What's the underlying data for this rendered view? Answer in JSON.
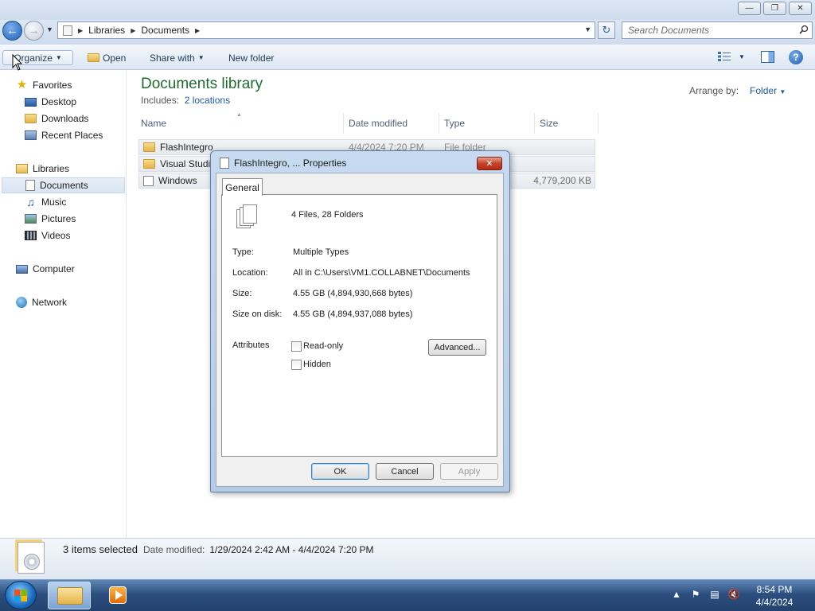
{
  "window": {
    "minimize_icon": "minimize-icon",
    "maximize_icon": "restore-icon",
    "close_icon": "close-icon"
  },
  "address": {
    "crumbs": [
      "Libraries",
      "Documents"
    ],
    "search_placeholder": "Search Documents"
  },
  "toolbar": {
    "organize": "Organize",
    "open": "Open",
    "share_with": "Share with",
    "new_folder": "New folder"
  },
  "sidebar": {
    "favorites": "Favorites",
    "desktop": "Desktop",
    "downloads": "Downloads",
    "recent_places": "Recent Places",
    "libraries": "Libraries",
    "documents": "Documents",
    "music": "Music",
    "pictures": "Pictures",
    "videos": "Videos",
    "computer": "Computer",
    "network": "Network"
  },
  "library": {
    "title": "Documents library",
    "includes_label": "Includes:",
    "locations": "2 locations",
    "arrange_label": "Arrange by:",
    "arrange_value": "Folder"
  },
  "columns": {
    "name": "Name",
    "date_modified": "Date modified",
    "type": "Type",
    "size": "Size"
  },
  "files": [
    {
      "name": "FlashIntegro",
      "date": "4/4/2024 7:20 PM",
      "type": "File folder",
      "size": ""
    },
    {
      "name": "Visual Studio",
      "date": "",
      "type": "",
      "size": ""
    },
    {
      "name": "Windows",
      "date": "",
      "type": "",
      "size": "4,779,200 KB"
    }
  ],
  "details": {
    "count": "3 items selected",
    "date_label": "Date modified:",
    "date_value": "1/29/2024 2:42 AM - 4/4/2024 7:20 PM"
  },
  "dialog": {
    "title": "FlashIntegro, ... Properties",
    "tab": "General",
    "summary": "4 Files, 28 Folders",
    "type_label": "Type:",
    "type_value": "Multiple Types",
    "location_label": "Location:",
    "location_value": "All in C:\\Users\\VM1.COLLABNET\\Documents",
    "size_label": "Size:",
    "size_value": "4.55 GB (4,894,930,668 bytes)",
    "size_disk_label": "Size on disk:",
    "size_disk_value": "4.55 GB (4,894,937,088 bytes)",
    "attributes_label": "Attributes",
    "readonly_label": "Read-only",
    "hidden_label": "Hidden",
    "advanced_button": "Advanced...",
    "ok_button": "OK",
    "cancel_button": "Cancel",
    "apply_button": "Apply"
  },
  "taskbar": {
    "time": "8:54 PM",
    "date": "4/4/2024"
  }
}
